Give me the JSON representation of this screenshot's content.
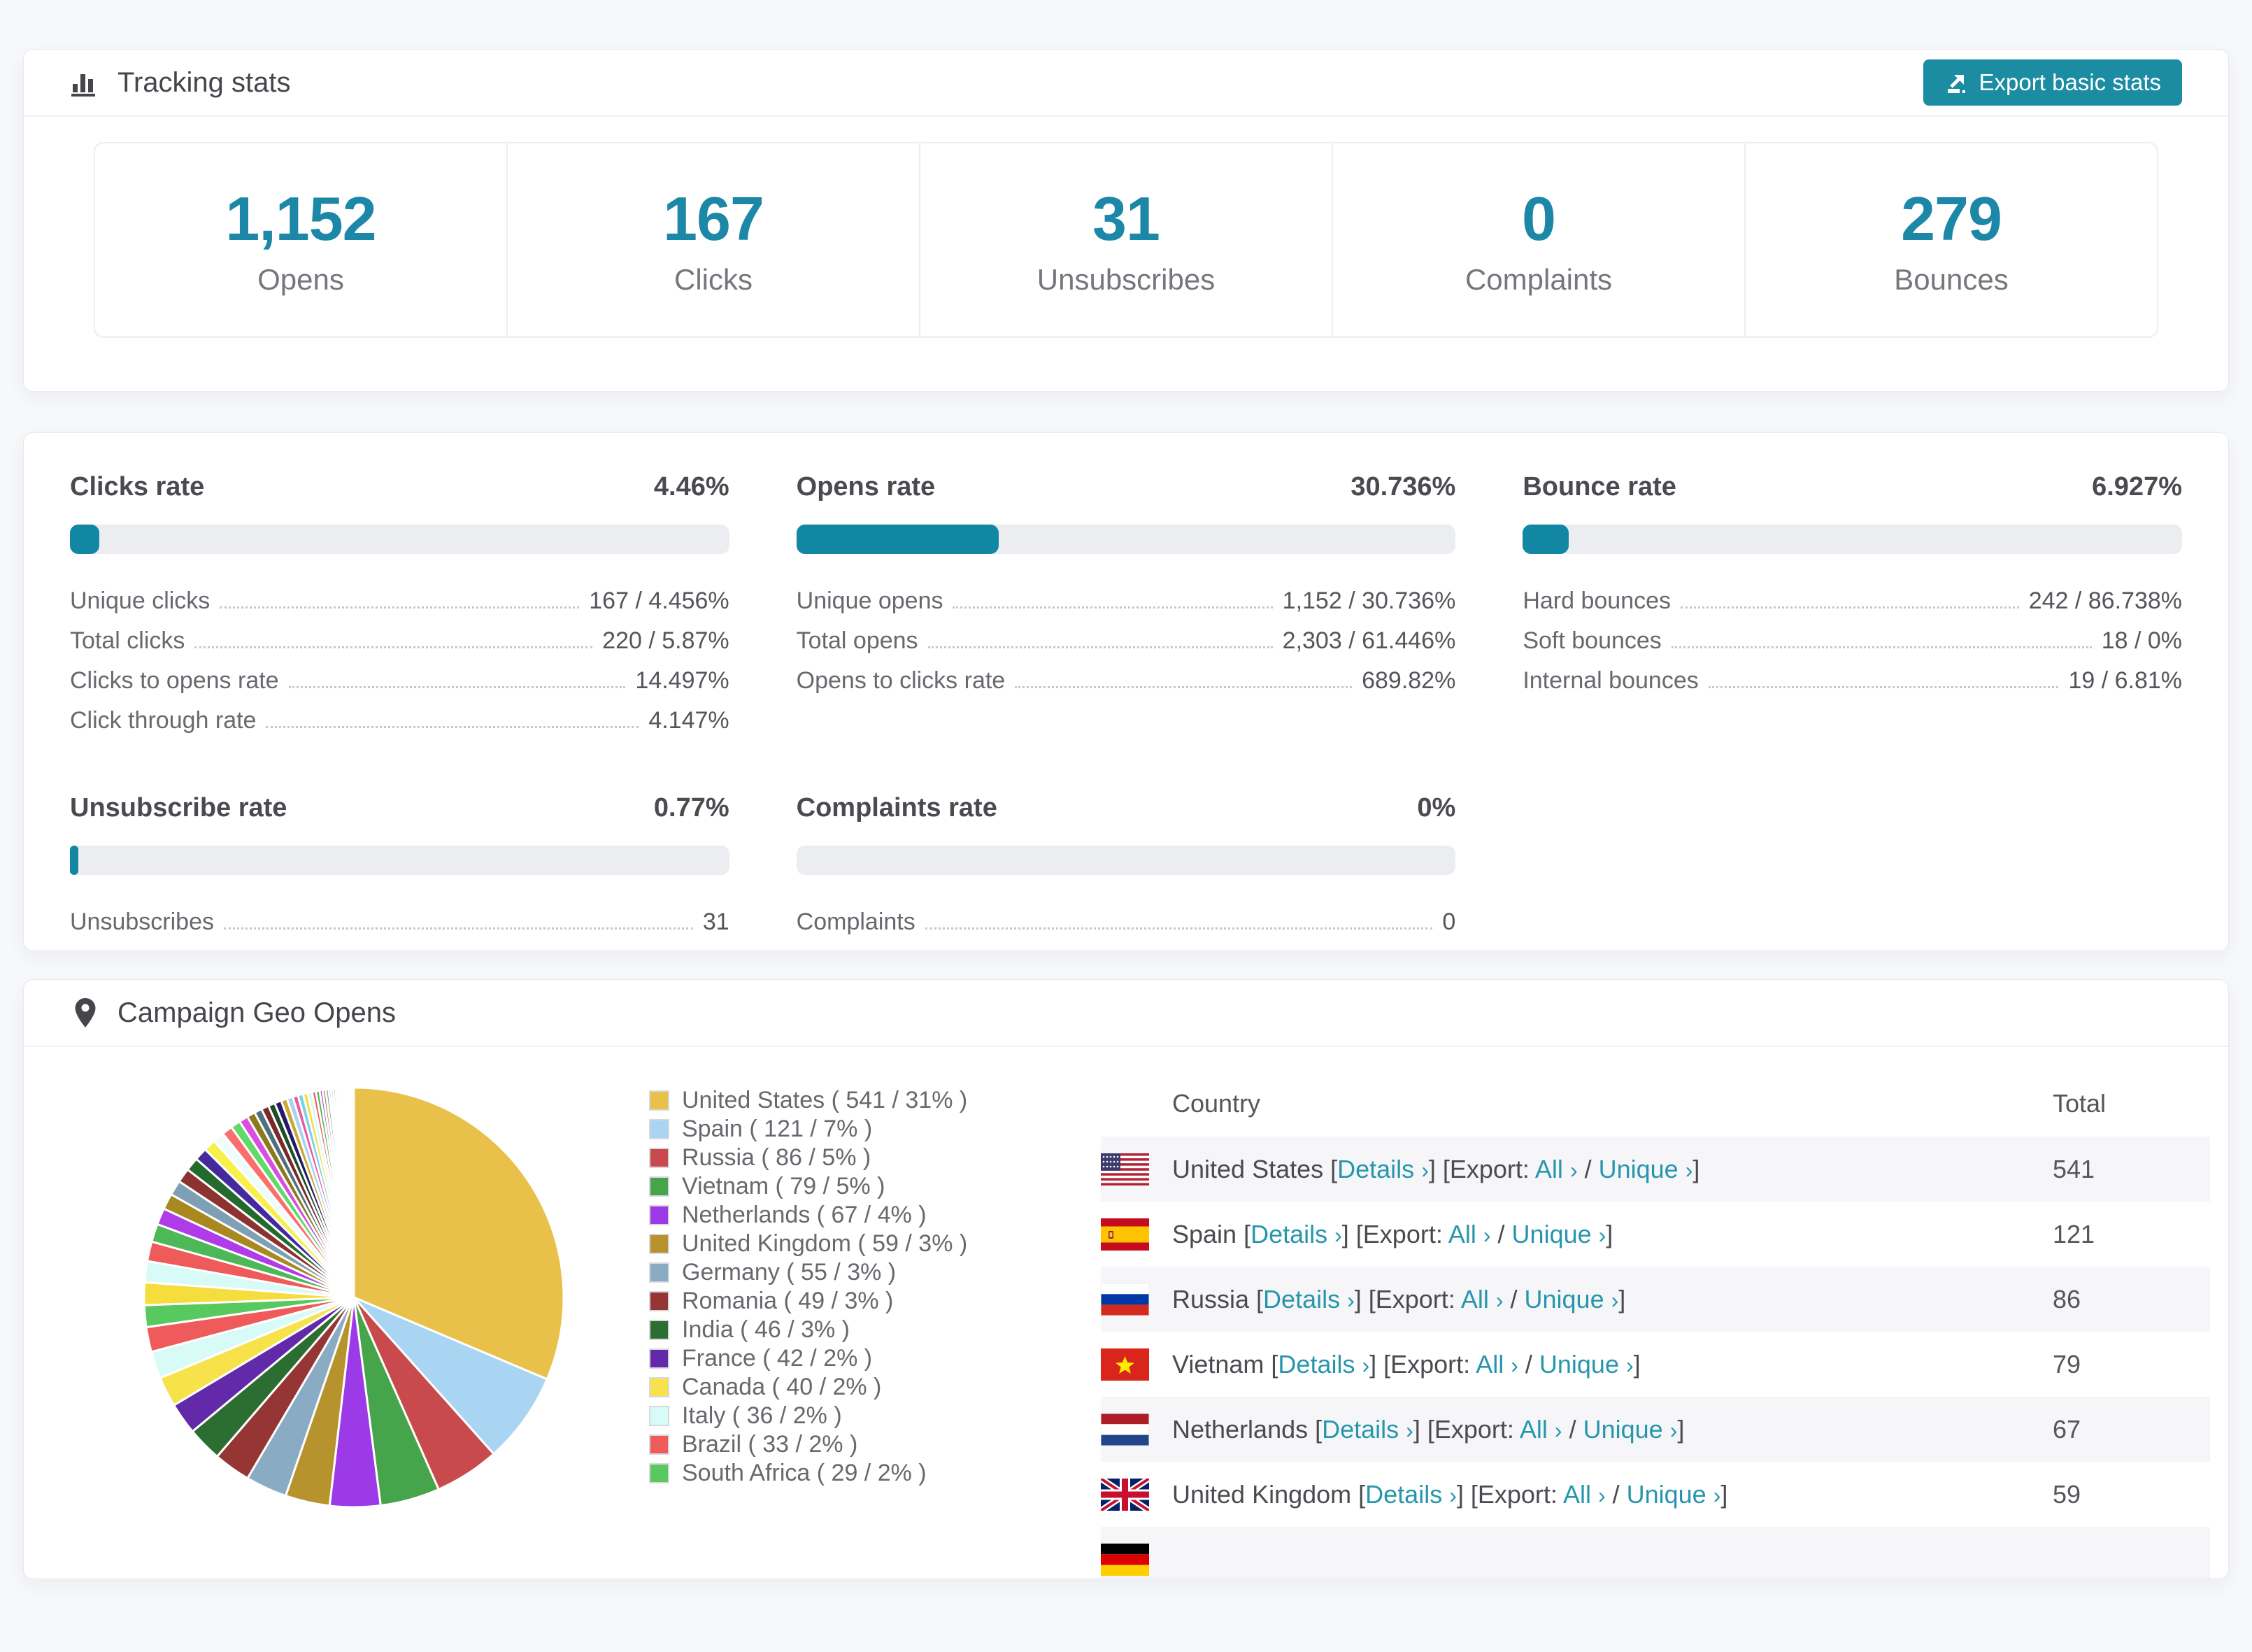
{
  "accent_color": "#1187a3",
  "button_color": "#1b8ca1",
  "link_color": "#2796ad",
  "tracking": {
    "title": "Tracking stats",
    "export_button": "Export basic stats",
    "summary": [
      {
        "value": "1,152",
        "label": "Opens"
      },
      {
        "value": "167",
        "label": "Clicks"
      },
      {
        "value": "31",
        "label": "Unsubscribes"
      },
      {
        "value": "0",
        "label": "Complaints"
      },
      {
        "value": "279",
        "label": "Bounces"
      }
    ]
  },
  "rates": {
    "sections": [
      {
        "title": "Clicks rate",
        "value": "4.46%",
        "percent": 4.46,
        "rows": [
          {
            "label": "Unique clicks",
            "value": "167 / 4.456%"
          },
          {
            "label": "Total clicks",
            "value": "220 / 5.87%"
          },
          {
            "label": "Clicks to opens rate",
            "value": "14.497%"
          },
          {
            "label": "Click through rate",
            "value": "4.147%"
          }
        ]
      },
      {
        "title": "Opens rate",
        "value": "30.736%",
        "percent": 30.736,
        "rows": [
          {
            "label": "Unique opens",
            "value": "1,152 / 30.736%"
          },
          {
            "label": "Total opens",
            "value": "2,303 / 61.446%"
          },
          {
            "label": "Opens to clicks rate",
            "value": "689.82%"
          }
        ]
      },
      {
        "title": "Bounce rate",
        "value": "6.927%",
        "percent": 6.927,
        "rows": [
          {
            "label": "Hard bounces",
            "value": "242 / 86.738%"
          },
          {
            "label": "Soft bounces",
            "value": "18 / 0%"
          },
          {
            "label": "Internal bounces",
            "value": "19 / 6.81%"
          }
        ]
      },
      {
        "title": "Unsubscribe rate",
        "value": "0.77%",
        "percent": 0.77,
        "rows": [
          {
            "label": "Unsubscribes",
            "value": "31"
          }
        ]
      },
      {
        "title": "Complaints rate",
        "value": "0%",
        "percent": 0,
        "rows": [
          {
            "label": "Complaints",
            "value": "0"
          }
        ]
      }
    ]
  },
  "geo": {
    "title": "Campaign Geo Opens",
    "legend": [
      {
        "label": "United States ( 541 / 31% )",
        "color": "#e9c14a"
      },
      {
        "label": "Spain ( 121 / 7% )",
        "color": "#aad5f2"
      },
      {
        "label": "Russia ( 86 / 5% )",
        "color": "#c94a4c"
      },
      {
        "label": "Vietnam ( 79 / 5% )",
        "color": "#46a54a"
      },
      {
        "label": "Netherlands ( 67 / 4% )",
        "color": "#9d3ae8"
      },
      {
        "label": "United Kingdom ( 59 / 3% )",
        "color": "#b6932d"
      },
      {
        "label": "Germany ( 55 / 3% )",
        "color": "#89abc4"
      },
      {
        "label": "Romania ( 49 / 3% )",
        "color": "#963634"
      },
      {
        "label": "India ( 46 / 3% )",
        "color": "#2c6e31"
      },
      {
        "label": "France ( 42 / 2% )",
        "color": "#6229a8"
      },
      {
        "label": "Canada ( 40 / 2% )",
        "color": "#f7e24c"
      },
      {
        "label": "Italy ( 36 / 2% )",
        "color": "#d8fbf8"
      },
      {
        "label": "Brazil ( 33 / 2% )",
        "color": "#ef5a5a"
      },
      {
        "label": "South Africa ( 29 / 2% )",
        "color": "#58c95e"
      }
    ],
    "table": {
      "columns": [
        "Country",
        "Total"
      ],
      "link_labels": {
        "details": "Details",
        "export_prefix": "Export:",
        "all": "All",
        "unique": "Unique",
        "chevron": "›"
      },
      "rows": [
        {
          "flag": "us",
          "country": "United States",
          "total": "541"
        },
        {
          "flag": "es",
          "country": "Spain",
          "total": "121"
        },
        {
          "flag": "ru",
          "country": "Russia",
          "total": "86"
        },
        {
          "flag": "vn",
          "country": "Vietnam",
          "total": "79"
        },
        {
          "flag": "nl",
          "country": "Netherlands",
          "total": "67"
        },
        {
          "flag": "gb",
          "country": "United Kingdom",
          "total": "59"
        },
        {
          "flag": "de",
          "country": "",
          "total": ""
        }
      ]
    }
  },
  "chart_data": {
    "type": "pie",
    "title": "Campaign Geo Opens",
    "unit": "opens per country",
    "labels": [
      "United States",
      "Spain",
      "Russia",
      "Vietnam",
      "Netherlands",
      "United Kingdom",
      "Germany",
      "Romania",
      "India",
      "France",
      "Canada",
      "Italy",
      "Brazil",
      "South Africa"
    ],
    "values": [
      541,
      121,
      86,
      79,
      67,
      59,
      55,
      49,
      46,
      42,
      40,
      36,
      33,
      29
    ],
    "percent_labels": [
      "31%",
      "7%",
      "5%",
      "5%",
      "4%",
      "3%",
      "3%",
      "3%",
      "3%",
      "2%",
      "2%",
      "2%",
      "2%",
      "2%"
    ],
    "colors": [
      "#e9c14a",
      "#aad5f2",
      "#c94a4c",
      "#46a54a",
      "#9d3ae8",
      "#b6932d",
      "#89abc4",
      "#963634",
      "#2c6e31",
      "#6229a8",
      "#f7e24c",
      "#d8fbf8",
      "#ef5a5a",
      "#58c95e"
    ],
    "others": {
      "note": "unlabeled small slices, estimated",
      "values": [
        30,
        28,
        26,
        24,
        22,
        21,
        20,
        19,
        18,
        17,
        16,
        15,
        14,
        13,
        12,
        11,
        10,
        10,
        9,
        9,
        8,
        8,
        7,
        7,
        6,
        6,
        5,
        5,
        4,
        4,
        4,
        3,
        3,
        3,
        3,
        2.5,
        2.5,
        2,
        2,
        2,
        1.5,
        1.5,
        1.2,
        1,
        1,
        0.8,
        0.7,
        0.6,
        0.5,
        0.4,
        0.3,
        0.3,
        0.2,
        0.2
      ],
      "palette": [
        "#f5dd3e",
        "#d8fbf8",
        "#ef5a5a",
        "#4db858",
        "#b03be8",
        "#a8891f",
        "#7f9fb5",
        "#8c3230",
        "#236b2d",
        "#452a9e",
        "#f7ef4a",
        "#effcfc",
        "#fa6e6e",
        "#62d96a",
        "#d84fe0",
        "#8a7a1e",
        "#50707f",
        "#7a2a28",
        "#1e4d28",
        "#261a66",
        "#c8a832",
        "#a8d2f0",
        "#e85aa0",
        "#7ad0e8"
      ]
    },
    "start_angle": "12 o'clock",
    "direction": "clockwise",
    "legend_position": "right"
  }
}
